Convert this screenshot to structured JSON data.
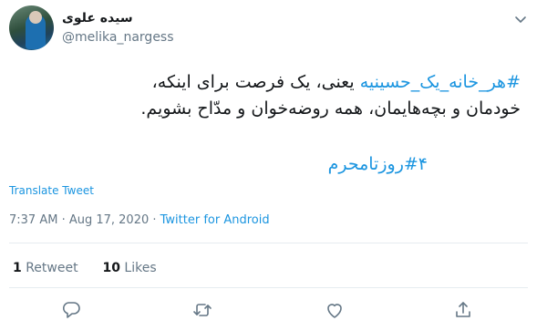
{
  "tweet": {
    "author_name": "سیده علوی",
    "author_handle": "@melika_nargess",
    "body_line1_hashtag": "#هر_خانه_یک_حسینیه",
    "body_line1_text": " یعنی، یک فرصت برای اینکه،",
    "body_line2_text": "خودمان و بچه‌هایمان، همه روضه‌خوان و مدّاح بشویم.",
    "hashtag2": "#۴روزتامحرم",
    "translate_label": "Translate Tweet",
    "timestamp": "7:37 AM · Aug 17, 2020 · ",
    "source": "Twitter for Android"
  },
  "stats": {
    "retweets_count": "1",
    "retweets_label": "Retweet",
    "likes_count": "10",
    "likes_label": "Likes"
  },
  "colors": {
    "accent": "#1b95e0",
    "secondary_text": "#657786",
    "divider": "#e6ecf0"
  },
  "icons": {
    "caret": "chevron-down-icon",
    "reply": "reply-icon",
    "retweet": "retweet-icon",
    "like": "heart-icon",
    "share": "share-icon"
  }
}
